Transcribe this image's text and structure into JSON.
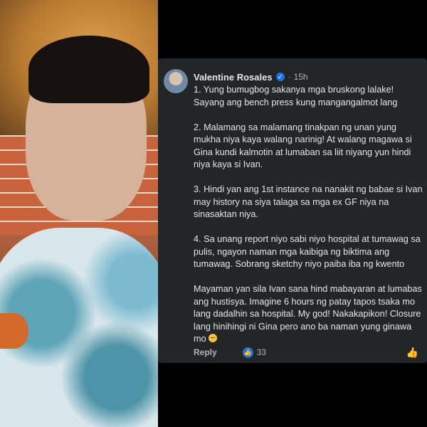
{
  "comment": {
    "author": "Valentine Rosales",
    "separator": "·",
    "time": "15h",
    "paragraphs": [
      "1. Yung bumugbog sakanya mga bruskong lalake! Sayang ang bench press kung mangangalmot lang",
      "2. Malamang sa malamang tinakpan ng unan yung mukha niya kaya walang narinig! At walang magawa si Gina kundi kalmotin at lumaban sa liit niyang yun hindi niya kaya si Ivan.",
      "3. Hindi yan ang 1st instance na nanakit ng babae si Ivan may history na siya talaga sa mga ex GF niya na sinasaktan niya.",
      "4. Sa unang report niyo sabi niyo hospital at tumawag sa pulis, ngayon naman mga kaibiga ng biktima ang tumawag. Sobrang sketchy niyo paiba iba ng kwento",
      "Mayaman yan sila Ivan sana hind mabayaran at lumabas ang hustisya. Imagine 6 hours ng patay tapos tsaka mo lang dadalhin sa hospital. My god! Nakakapikon! Closure lang hinihingi ni Gina pero ano ba naman yung ginawa mo"
    ],
    "reply_label": "Reply",
    "like_count": "33",
    "icons": {
      "verified": "verified-badge-icon",
      "emoji": "unamused-face-emoji-icon",
      "like": "like-reaction-icon",
      "thumb": "thumbs-up-outline-icon"
    }
  },
  "colors": {
    "card_bg": "#242526",
    "text_primary": "#e4e6eb",
    "text_secondary": "#b0b3b8",
    "accent": "#1b74e4"
  }
}
